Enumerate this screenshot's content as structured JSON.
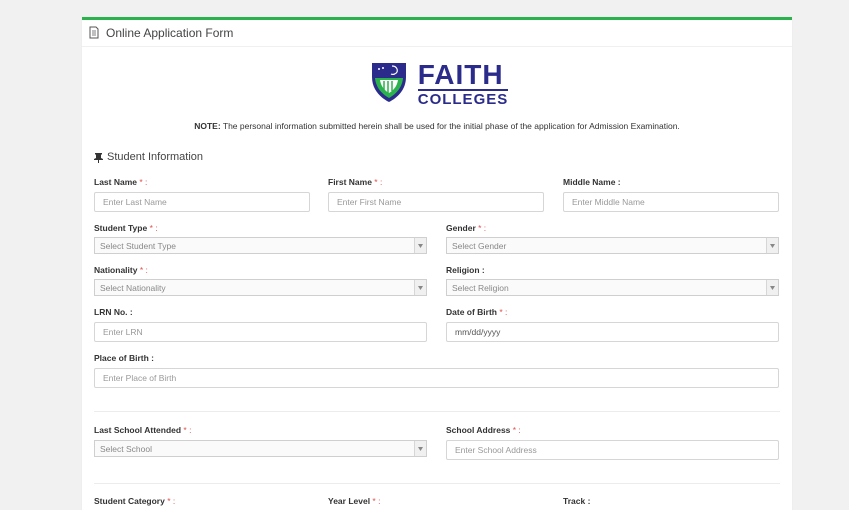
{
  "header": {
    "title": "Online Application Form",
    "icon": "document-icon"
  },
  "logo": {
    "top": "FAITH",
    "bottom": "COLLEGES",
    "colors": {
      "primary": "#2b2b8c",
      "accent": "#2bb24c"
    }
  },
  "note": {
    "label": "NOTE:",
    "text": " The personal information submitted herein shall be used for the initial phase of the application for Admission Examination."
  },
  "section": {
    "title": "Student Information",
    "icon": "pin-icon"
  },
  "fields": {
    "last_name": {
      "label": "Last Name",
      "placeholder": "Enter Last Name"
    },
    "first_name": {
      "label": "First Name",
      "placeholder": "Enter First Name"
    },
    "middle_name": {
      "label": "Middle Name :",
      "placeholder": "Enter Middle Name"
    },
    "student_type": {
      "label": "Student Type",
      "value": "Select Student Type"
    },
    "gender": {
      "label": "Gender",
      "value": "Select Gender"
    },
    "nationality": {
      "label": "Nationality",
      "value": "Select Nationality"
    },
    "religion": {
      "label": "Religion :",
      "value": "Select Religion"
    },
    "lrn": {
      "label": "LRN No. :",
      "placeholder": "Enter LRN"
    },
    "dob": {
      "label": "Date of Birth",
      "value": "mm/dd/yyyy"
    },
    "place_of_birth": {
      "label": "Place of Birth :",
      "placeholder": "Enter Place of Birth"
    },
    "last_school": {
      "label": "Last School Attended",
      "value": "Select School"
    },
    "school_address": {
      "label": "School Address",
      "placeholder": "Enter School Address"
    },
    "student_category": {
      "label": "Student Category"
    },
    "year_level": {
      "label": "Year Level"
    },
    "track": {
      "label": "Track :"
    }
  },
  "required_marker": " * :"
}
